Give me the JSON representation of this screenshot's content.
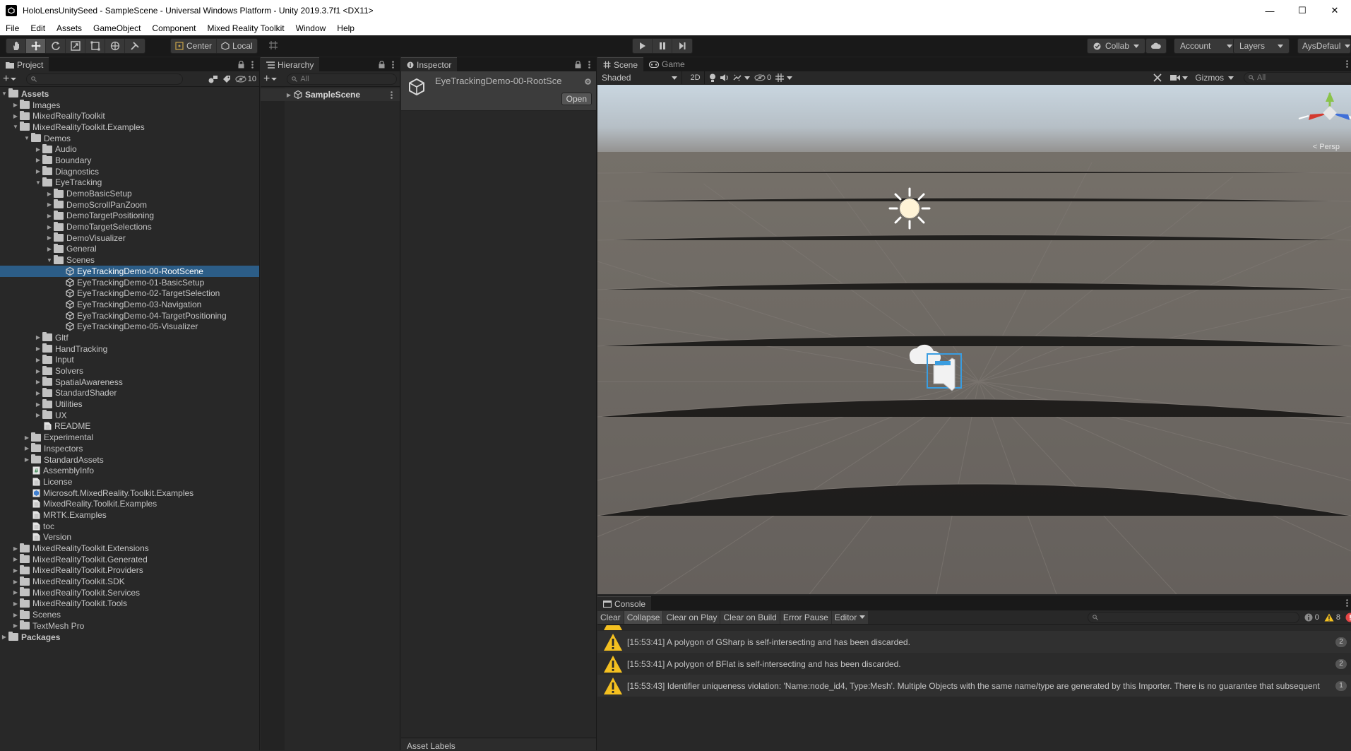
{
  "window": {
    "title": "HoloLensUnitySeed - SampleScene - Universal Windows Platform - Unity 2019.3.7f1 <DX11>",
    "minimize": "—",
    "maximize": "☐",
    "close": "✕"
  },
  "menu": [
    "File",
    "Edit",
    "Assets",
    "GameObject",
    "Component",
    "Mixed Reality Toolkit",
    "Window",
    "Help"
  ],
  "toolbar": {
    "pivot_label": "Center",
    "space_label": "Local",
    "collab_label": "Collab",
    "account_label": "Account",
    "layers_label": "Layers",
    "layout_label": "AysDefaul"
  },
  "project": {
    "tab": "Project",
    "hidden_count": "10",
    "tree": [
      {
        "label": "Assets",
        "depth": 0,
        "type": "folder",
        "arrow": "open",
        "bold": true
      },
      {
        "label": "Images",
        "depth": 1,
        "type": "folder",
        "arrow": "closed"
      },
      {
        "label": "MixedRealityToolkit",
        "depth": 1,
        "type": "folder",
        "arrow": "closed"
      },
      {
        "label": "MixedRealityToolkit.Examples",
        "depth": 1,
        "type": "folder",
        "arrow": "open"
      },
      {
        "label": "Demos",
        "depth": 2,
        "type": "folder",
        "arrow": "open"
      },
      {
        "label": "Audio",
        "depth": 3,
        "type": "folder",
        "arrow": "closed"
      },
      {
        "label": "Boundary",
        "depth": 3,
        "type": "folder",
        "arrow": "closed"
      },
      {
        "label": "Diagnostics",
        "depth": 3,
        "type": "folder",
        "arrow": "closed"
      },
      {
        "label": "EyeTracking",
        "depth": 3,
        "type": "folder",
        "arrow": "open"
      },
      {
        "label": "DemoBasicSetup",
        "depth": 4,
        "type": "folder",
        "arrow": "closed"
      },
      {
        "label": "DemoScrollPanZoom",
        "depth": 4,
        "type": "folder",
        "arrow": "closed"
      },
      {
        "label": "DemoTargetPositioning",
        "depth": 4,
        "type": "folder",
        "arrow": "closed"
      },
      {
        "label": "DemoTargetSelections",
        "depth": 4,
        "type": "folder",
        "arrow": "closed"
      },
      {
        "label": "DemoVisualizer",
        "depth": 4,
        "type": "folder",
        "arrow": "closed"
      },
      {
        "label": "General",
        "depth": 4,
        "type": "folder",
        "arrow": "closed"
      },
      {
        "label": "Scenes",
        "depth": 4,
        "type": "folder",
        "arrow": "open"
      },
      {
        "label": "EyeTrackingDemo-00-RootScene",
        "depth": 5,
        "type": "scene",
        "arrow": "none",
        "selected": true
      },
      {
        "label": "EyeTrackingDemo-01-BasicSetup",
        "depth": 5,
        "type": "scene",
        "arrow": "none"
      },
      {
        "label": "EyeTrackingDemo-02-TargetSelection",
        "depth": 5,
        "type": "scene",
        "arrow": "none"
      },
      {
        "label": "EyeTrackingDemo-03-Navigation",
        "depth": 5,
        "type": "scene",
        "arrow": "none"
      },
      {
        "label": "EyeTrackingDemo-04-TargetPositioning",
        "depth": 5,
        "type": "scene",
        "arrow": "none"
      },
      {
        "label": "EyeTrackingDemo-05-Visualizer",
        "depth": 5,
        "type": "scene",
        "arrow": "none"
      },
      {
        "label": "Gltf",
        "depth": 3,
        "type": "folder",
        "arrow": "closed"
      },
      {
        "label": "HandTracking",
        "depth": 3,
        "type": "folder",
        "arrow": "closed"
      },
      {
        "label": "Input",
        "depth": 3,
        "type": "folder",
        "arrow": "closed"
      },
      {
        "label": "Solvers",
        "depth": 3,
        "type": "folder",
        "arrow": "closed"
      },
      {
        "label": "SpatialAwareness",
        "depth": 3,
        "type": "folder",
        "arrow": "closed"
      },
      {
        "label": "StandardShader",
        "depth": 3,
        "type": "folder",
        "arrow": "closed"
      },
      {
        "label": "Utilities",
        "depth": 3,
        "type": "folder",
        "arrow": "closed"
      },
      {
        "label": "UX",
        "depth": 3,
        "type": "folder",
        "arrow": "closed"
      },
      {
        "label": "README",
        "depth": 3,
        "type": "file",
        "arrow": "none"
      },
      {
        "label": "Experimental",
        "depth": 2,
        "type": "folder",
        "arrow": "closed"
      },
      {
        "label": "Inspectors",
        "depth": 2,
        "type": "folder",
        "arrow": "closed"
      },
      {
        "label": "StandardAssets",
        "depth": 2,
        "type": "folder",
        "arrow": "closed"
      },
      {
        "label": "AssemblyInfo",
        "depth": 2,
        "type": "script",
        "arrow": "none"
      },
      {
        "label": "License",
        "depth": 2,
        "type": "file",
        "arrow": "none"
      },
      {
        "label": "Microsoft.MixedReality.Toolkit.Examples",
        "depth": 2,
        "type": "asmdef",
        "arrow": "none"
      },
      {
        "label": "MixedReality.Toolkit.Examples",
        "depth": 2,
        "type": "file",
        "arrow": "none"
      },
      {
        "label": "MRTK.Examples",
        "depth": 2,
        "type": "file",
        "arrow": "none"
      },
      {
        "label": "toc",
        "depth": 2,
        "type": "file",
        "arrow": "none"
      },
      {
        "label": "Version",
        "depth": 2,
        "type": "file",
        "arrow": "none"
      },
      {
        "label": "MixedRealityToolkit.Extensions",
        "depth": 1,
        "type": "folder",
        "arrow": "closed"
      },
      {
        "label": "MixedRealityToolkit.Generated",
        "depth": 1,
        "type": "folder",
        "arrow": "closed"
      },
      {
        "label": "MixedRealityToolkit.Providers",
        "depth": 1,
        "type": "folder",
        "arrow": "closed"
      },
      {
        "label": "MixedRealityToolkit.SDK",
        "depth": 1,
        "type": "folder",
        "arrow": "closed"
      },
      {
        "label": "MixedRealityToolkit.Services",
        "depth": 1,
        "type": "folder",
        "arrow": "closed"
      },
      {
        "label": "MixedRealityToolkit.Tools",
        "depth": 1,
        "type": "folder",
        "arrow": "closed"
      },
      {
        "label": "Scenes",
        "depth": 1,
        "type": "folder",
        "arrow": "closed"
      },
      {
        "label": "TextMesh Pro",
        "depth": 1,
        "type": "folder",
        "arrow": "closed"
      },
      {
        "label": "Packages",
        "depth": 0,
        "type": "folder",
        "arrow": "closed",
        "bold": true
      }
    ]
  },
  "hierarchy": {
    "tab": "Hierarchy",
    "search_placeholder": "All",
    "scene": "SampleScene"
  },
  "inspector": {
    "tab": "Inspector",
    "asset_name": "EyeTrackingDemo-00-RootSce",
    "open_button": "Open",
    "footer": "Asset Labels"
  },
  "scene": {
    "tab_scene": "Scene",
    "tab_game": "Game",
    "shading": "Shaded",
    "mode_2d": "2D",
    "hidden_count": "0",
    "gizmos": "Gizmos",
    "search_placeholder": "All",
    "persp_label": "Persp"
  },
  "console": {
    "tab": "Console",
    "buttons": {
      "clear": "Clear",
      "collapse": "Collapse",
      "clear_on_play": "Clear on Play",
      "clear_on_build": "Clear on Build",
      "error_pause": "Error Pause",
      "editor": "Editor"
    },
    "counts": {
      "info": "0",
      "warn": "8"
    },
    "messages": [
      {
        "text": "[15:53:41] A polygon of GSharp is self-intersecting and has been discarded.",
        "count": "2"
      },
      {
        "text": "[15:53:41] A polygon of BFlat is self-intersecting and has been discarded.",
        "count": "2"
      },
      {
        "text": "[15:53:43] Identifier uniqueness violation: 'Name:node_id4, Type:Mesh'. Multiple Objects with the same name/type are generated by this Importer. There is no guarantee that subsequent",
        "count": "1"
      }
    ]
  },
  "colors": {
    "selection": "#2c5d87",
    "warning": "#f4c020",
    "gizmo_y": "#8ac34a",
    "gizmo_x": "#d33a2f",
    "gizmo_z": "#3f6fd8"
  }
}
